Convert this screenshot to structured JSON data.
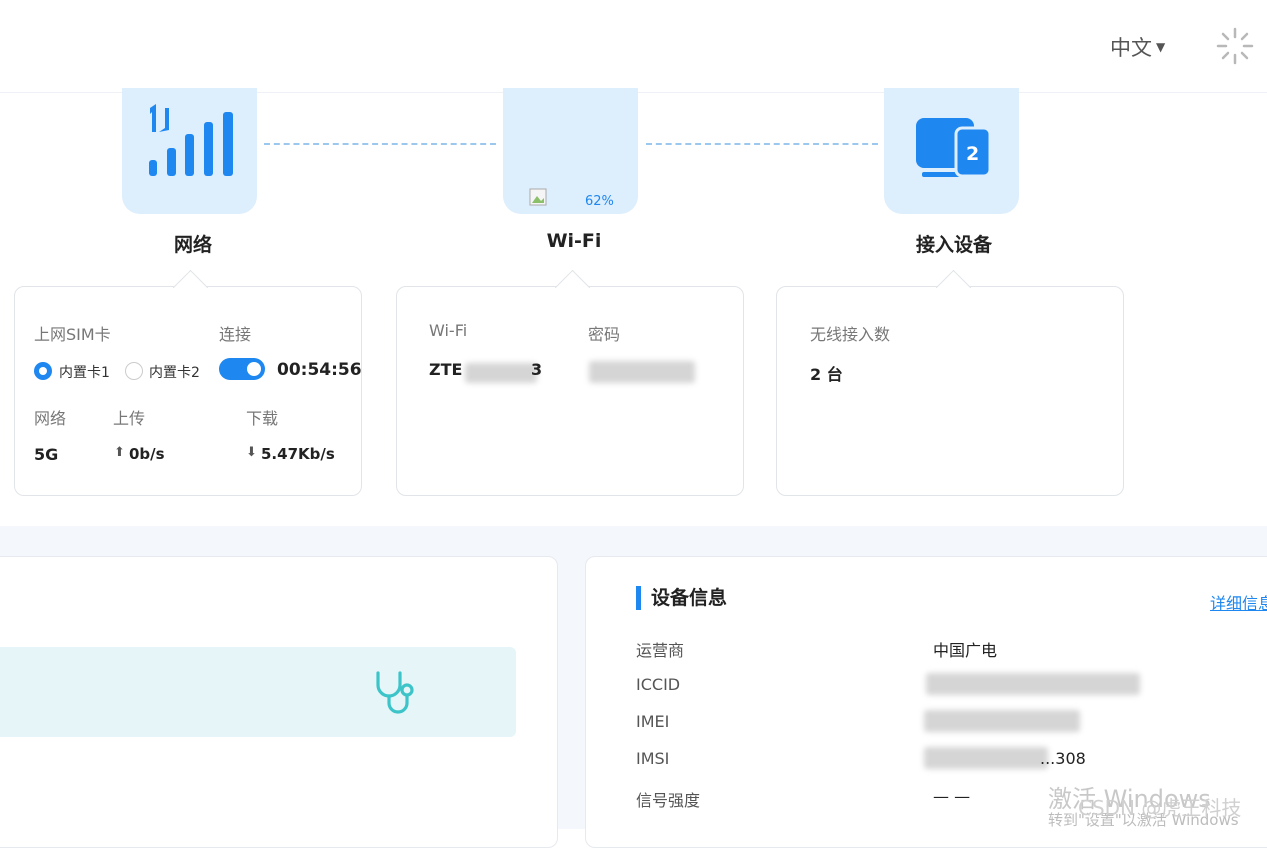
{
  "header": {
    "language": "中文"
  },
  "nodes": {
    "network": {
      "title": "网络"
    },
    "wifi": {
      "title": "Wi-Fi",
      "percent": "62%"
    },
    "devices": {
      "title": "接入设备",
      "badge": "2"
    }
  },
  "network_card": {
    "sim_label": "上网SIM卡",
    "connect_label": "连接",
    "sim1": "内置卡1",
    "sim2": "内置卡2",
    "selected_sim": "内置卡1",
    "connected": true,
    "duration": "00:54:56",
    "net_label": "网络",
    "up_label": "上传",
    "down_label": "下载",
    "net_value": "5G",
    "up_value": "0b/s",
    "down_value": "5.47Kb/s"
  },
  "wifi_card": {
    "ssid_label": "Wi-Fi",
    "password_label": "密码",
    "ssid_value": "ZTE",
    "ssid_suffix": "3"
  },
  "devices_card": {
    "label": "无线接入数",
    "value": "2 台"
  },
  "device_info": {
    "title": "设备信息",
    "more_link": "详细信息",
    "rows": [
      {
        "label": "运营商",
        "value": "中国广电"
      },
      {
        "label": "ICCID",
        "value": ""
      },
      {
        "label": "IMEI",
        "value": ""
      },
      {
        "label": "IMSI",
        "value": "...308"
      },
      {
        "label": "信号强度",
        "value": "— —"
      }
    ]
  },
  "watermark": {
    "line1": "激活 Windows",
    "line2": "转到\"设置\"以激活 Windows",
    "csdn": "CSDN @虎王科技"
  },
  "colors": {
    "accent": "#1e87f0",
    "icon_bg": "#ddeefc",
    "diagnose_bg": "#e5f5f8",
    "diagnose_icon": "#3cc4c9"
  }
}
